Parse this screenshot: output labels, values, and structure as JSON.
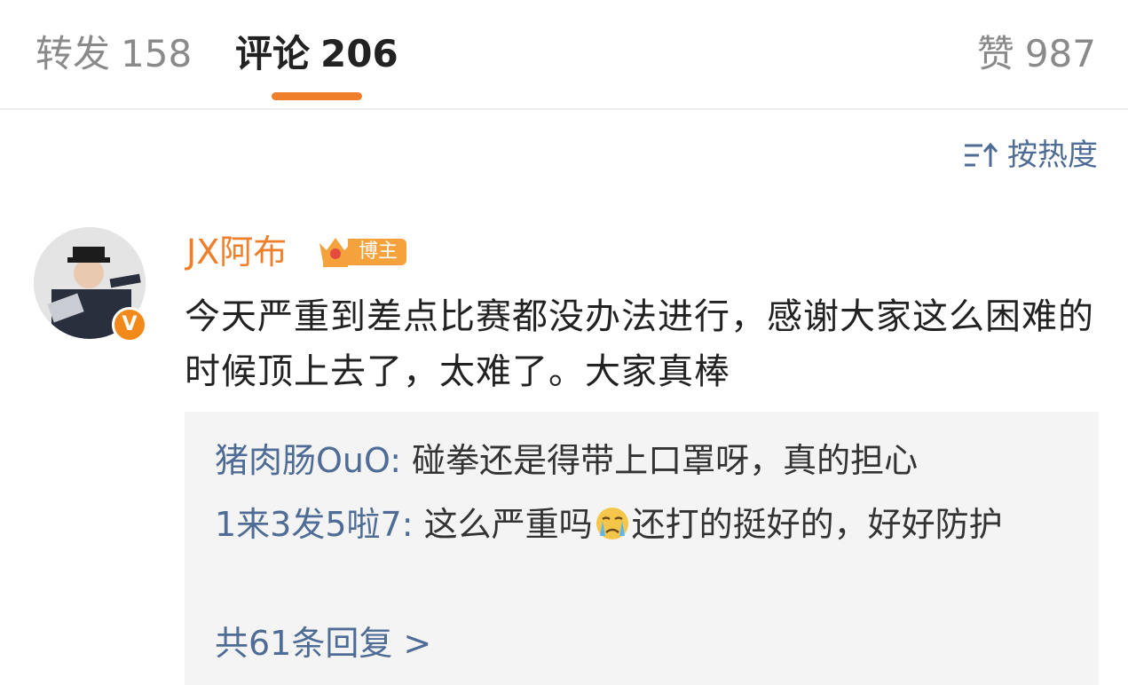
{
  "tabs": {
    "repost": {
      "label": "转发",
      "count": "158"
    },
    "comment": {
      "label": "评论",
      "count": "206"
    },
    "like": {
      "label": "赞",
      "count": "987"
    }
  },
  "sort": {
    "label": "按热度",
    "icon": "sort-icon"
  },
  "comment": {
    "username": "JX阿布",
    "badge": "博主",
    "verified_mark": "V",
    "text": "今天严重到差点比赛都没办法进行，感谢大家这么困难的时候顶上去了，太难了。大家真棒"
  },
  "replies": [
    {
      "author": "猪肉肠OuO:",
      "text_before": " 碰拳还是得带上口罩呀，真的担心",
      "emoji": "",
      "text_after": ""
    },
    {
      "author": "1来3发5啦7:",
      "text_before": " 这么严重吗",
      "emoji": "crying-face-emoji",
      "text_after": "还打的挺好的，好好防护"
    }
  ],
  "more_replies": "共61条回复 >",
  "colors": {
    "accent_orange": "#f07f2c",
    "link_blue": "#4e6c95",
    "reply_bg": "#f4f4f4"
  }
}
